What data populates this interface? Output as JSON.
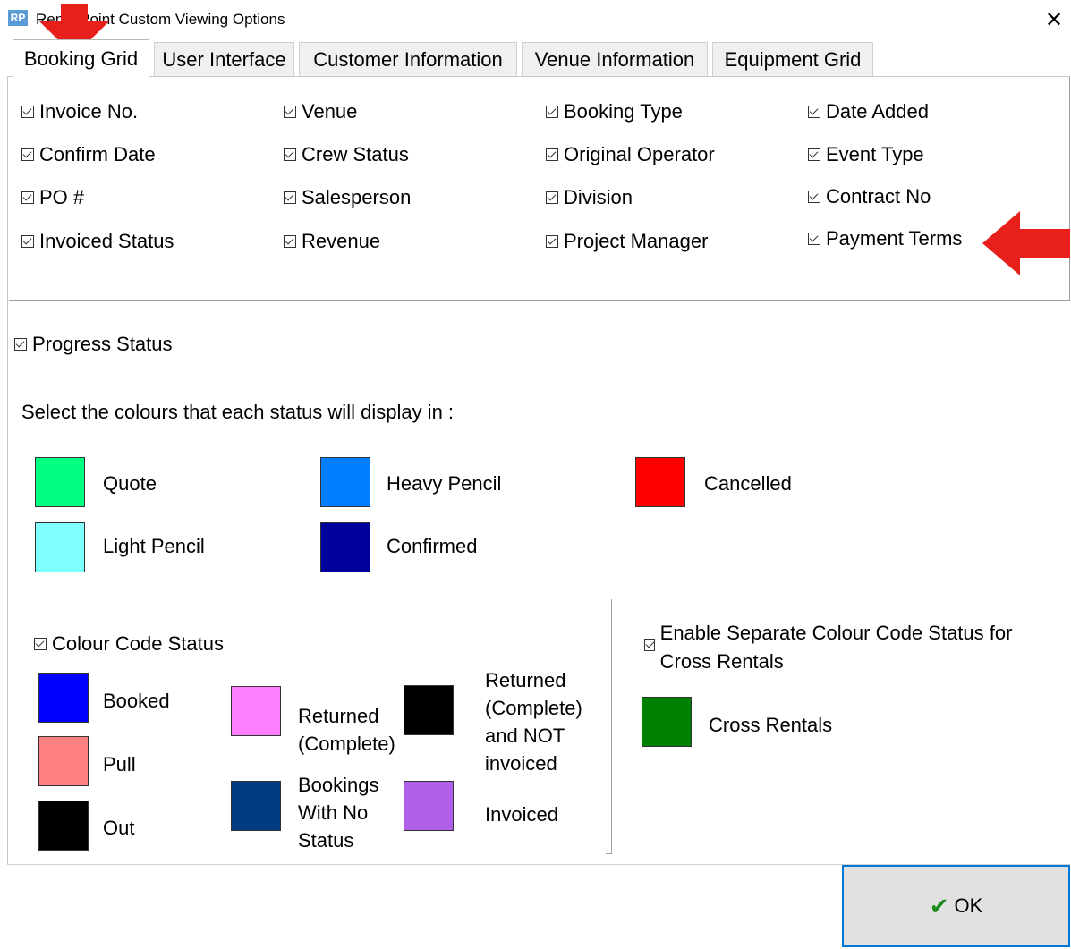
{
  "window": {
    "icon_text": "RP",
    "title": "RentalPoint Custom Viewing Options",
    "close_glyph": "✕"
  },
  "tabs": [
    {
      "label": "Booking Grid",
      "active": true
    },
    {
      "label": "User Interface"
    },
    {
      "label": "Customer Information"
    },
    {
      "label": "Venue Information"
    },
    {
      "label": "Equipment Grid"
    }
  ],
  "columns_options": [
    "Invoice No.",
    "Venue",
    "Booking Type",
    "Date Added",
    "Confirm Date",
    "Crew Status",
    "Original Operator",
    "Event Type",
    "PO #",
    "Salesperson",
    "Division",
    "Contract No",
    "Invoiced Status",
    "Revenue",
    "Project Manager",
    "Payment Terms"
  ],
  "progress": {
    "checkbox_label": "Progress Status",
    "instruction": "Select the colours that each status will display in :",
    "statuses": [
      {
        "label": "Quote",
        "color": "#00ff80"
      },
      {
        "label": "Heavy Pencil",
        "color": "#0080ff"
      },
      {
        "label": "Cancelled",
        "color": "#ff0000"
      },
      {
        "label": "Light Pencil",
        "color": "#80ffff"
      },
      {
        "label": "Confirmed",
        "color": "#00009c"
      }
    ]
  },
  "colour_code": {
    "checkbox_label": "Colour Code Status",
    "items": [
      {
        "label": "Booked",
        "color": "#0000ff"
      },
      {
        "label": "Pull",
        "color": "#ff8080"
      },
      {
        "label": "Out",
        "color": "#000000"
      },
      {
        "label": "Returned (Complete)",
        "color": "#ff80ff"
      },
      {
        "label": "Bookings With No Status",
        "color": "#003c80"
      },
      {
        "label": "Returned (Complete) and NOT invoiced",
        "color": "#000000"
      },
      {
        "label": "Invoiced",
        "color": "#b060e8"
      }
    ]
  },
  "cross_rentals": {
    "checkbox_label": "Enable Separate Colour Code Status for Cross Rentals",
    "label": "Cross Rentals",
    "color": "#008000"
  },
  "ok_button": {
    "label": "OK"
  },
  "annotation_color": "#e8201c"
}
